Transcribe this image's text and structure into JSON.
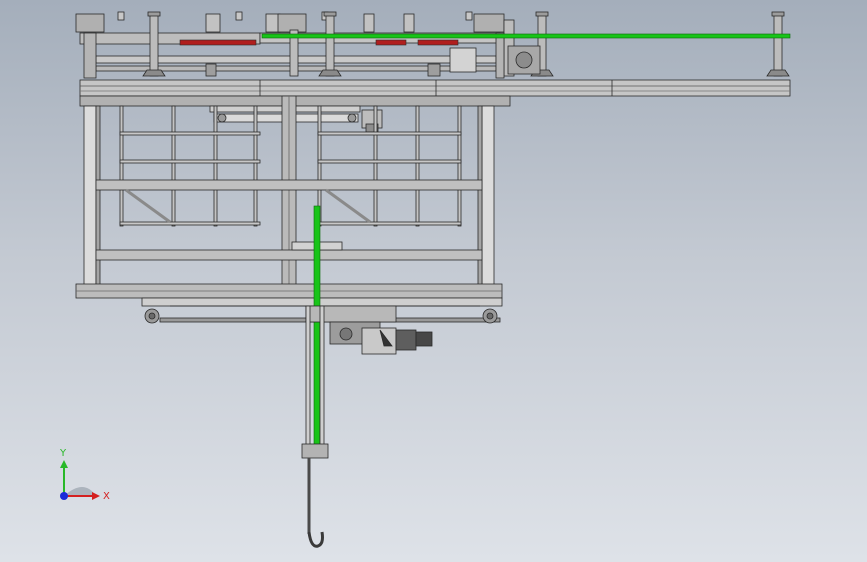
{
  "viewport": {
    "background_top": "#a4aebb",
    "background_bottom": "#dee2e8"
  },
  "model": {
    "line_color": "#2a2a2a",
    "steel_fill": "#bfbfbf",
    "steel_dark": "#7c7c7c",
    "rail_color": "#18c418",
    "highlight_color": "#b01e1e"
  },
  "triad": {
    "x_label": "X",
    "y_label": "Y",
    "x_color": "#d42020",
    "y_color": "#28b828",
    "z_color": "#1a2cd8"
  }
}
